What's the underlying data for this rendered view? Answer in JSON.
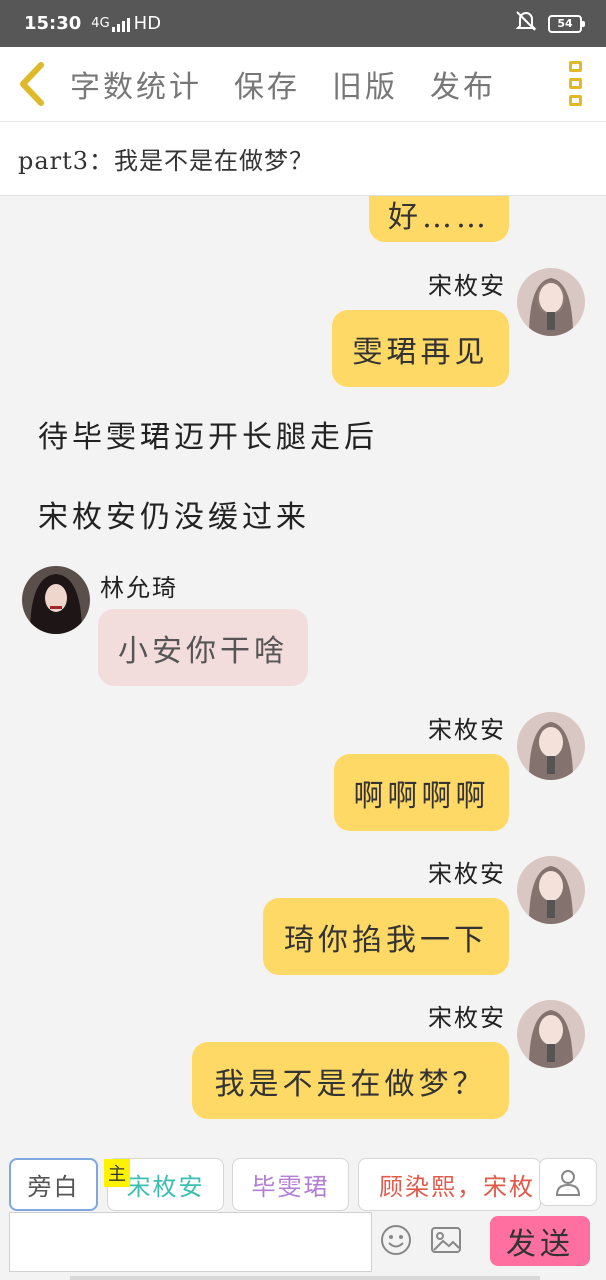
{
  "status_bar": {
    "time": "15:30",
    "network": "4G",
    "hd": "HD",
    "battery": "54"
  },
  "top_bar": {
    "menu": [
      "字数统计",
      "保存",
      "旧版",
      "发布"
    ]
  },
  "chapter_title": "part3：我是不是在做梦？",
  "chat": {
    "partial_bubble": "好……",
    "messages": [
      {
        "type": "right",
        "name": "宋枚安",
        "text": "雯珺再见"
      },
      {
        "type": "narration",
        "text": "待毕雯珺迈开长腿走后"
      },
      {
        "type": "narration",
        "text": "宋枚安仍没缓过来"
      },
      {
        "type": "left",
        "name": "林允琦",
        "text": "小安你干啥"
      },
      {
        "type": "right",
        "name": "宋枚安",
        "text": "啊啊啊啊"
      },
      {
        "type": "right",
        "name": "宋枚安",
        "text": "琦你掐我一下"
      },
      {
        "type": "right",
        "name": "宋枚安",
        "text": "我是不是在做梦？"
      }
    ]
  },
  "bottom": {
    "roles": [
      {
        "label": "旁白",
        "color": "#555555"
      },
      {
        "label": "宋枚安",
        "color": "#3cbfb0"
      },
      {
        "label": "毕雯珺",
        "color": "#b27fd6"
      },
      {
        "label": "顾染熙，宋枚",
        "color": "#e25a4a"
      }
    ],
    "main_tag": "主",
    "input_placeholder": "",
    "send_label": "发送"
  },
  "colors": {
    "accent": "#ffd966",
    "send": "#ff6fa0",
    "left_bubble": "#f3dcdc"
  }
}
